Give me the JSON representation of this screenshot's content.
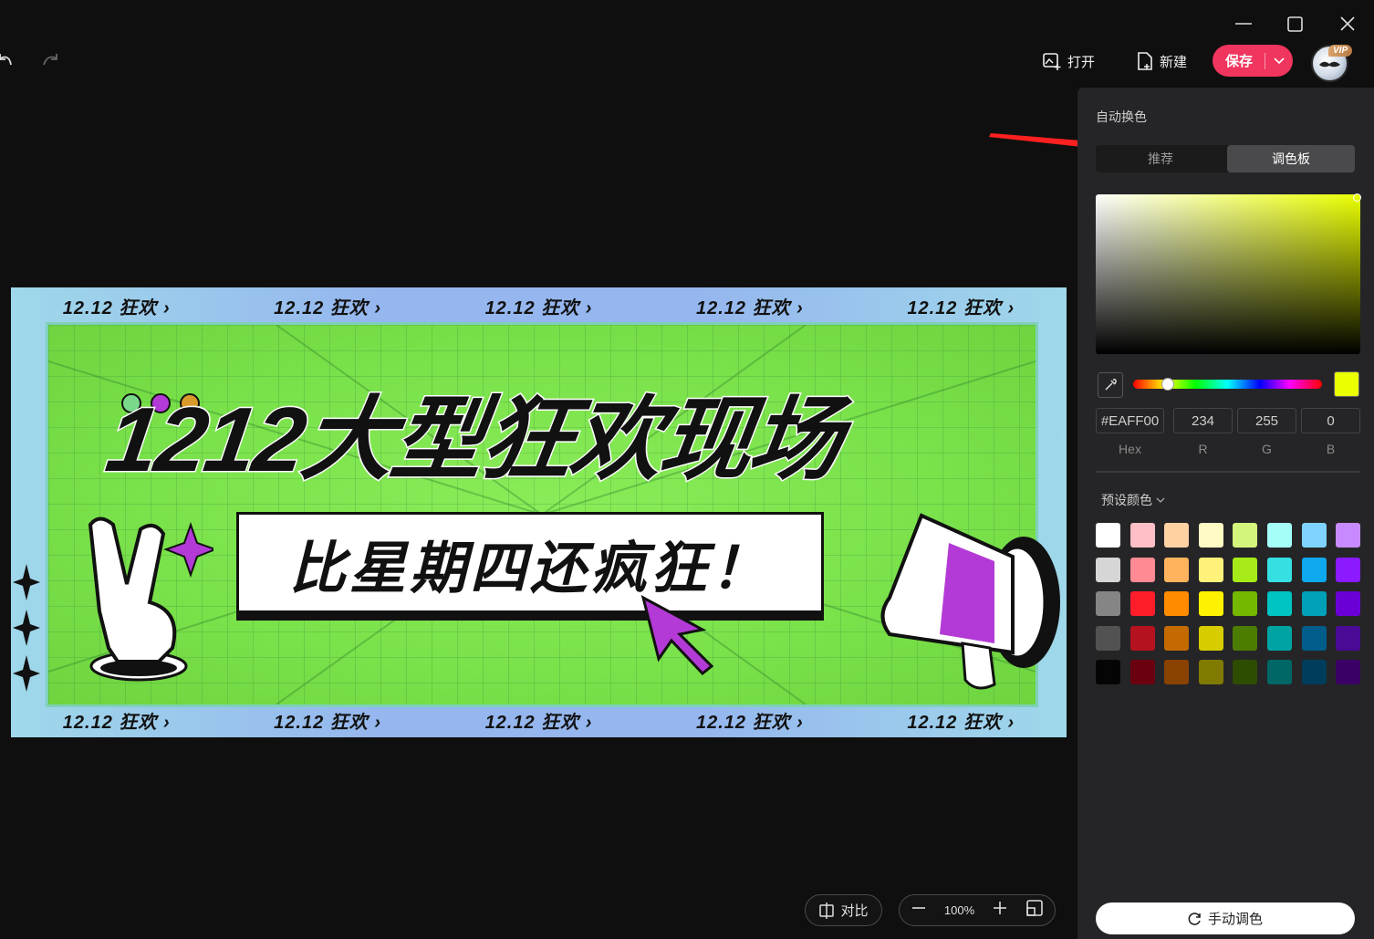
{
  "toolbar": {
    "open_label": "打开",
    "new_label": "新建",
    "save_label": "保存"
  },
  "avatar": {
    "badge": "VIP"
  },
  "banner": {
    "strip_items": [
      "12.12 狂欢 ›",
      "12.12 狂欢 ›",
      "12.12 狂欢 ›",
      "12.12 狂欢 ›",
      "12.12 狂欢 ›"
    ],
    "headline": "1212大型狂欢现场",
    "subline": "比星期四还疯狂！",
    "dot_colors": [
      "#7ad88a",
      "#b33ad6",
      "#d89a2a"
    ]
  },
  "zoom": {
    "compare_label": "对比",
    "level": "100%"
  },
  "panel": {
    "title": "自动换色",
    "tabs": [
      "推荐",
      "调色板"
    ],
    "active_tab": "调色板",
    "color": {
      "hex": "#EAFF00",
      "r": "234",
      "g": "255",
      "b": "0",
      "hue_fraction": 0.18
    },
    "labels": {
      "hex": "Hex",
      "r": "R",
      "g": "G",
      "b": "B"
    },
    "presets_title": "预设颜色",
    "presets": [
      "#ffffff",
      "#ffbfc6",
      "#ffd1a3",
      "#fff9c4",
      "#d4f57b",
      "#a5fff8",
      "#7fd4ff",
      "#c78bff",
      "#d6d6d6",
      "#ff8a94",
      "#ffb35c",
      "#fff27a",
      "#a6eb17",
      "#36e0e2",
      "#0ea8ee",
      "#8b1aff",
      "#858585",
      "#ff1c2b",
      "#ff8c00",
      "#fff200",
      "#75b800",
      "#00c4c4",
      "#00a0b8",
      "#6b00d6",
      "#525252",
      "#b5121f",
      "#c46a00",
      "#d6cc00",
      "#4d7d00",
      "#00a3a3",
      "#005d8a",
      "#4a0a96",
      "#050505",
      "#6b0010",
      "#8a4200",
      "#807a00",
      "#2e4d00",
      "#006666",
      "#003d5c",
      "#3a0066"
    ],
    "manual_label": "手动调色"
  },
  "accent": {
    "save": "#f0355e",
    "annotation": "#ff2020"
  }
}
